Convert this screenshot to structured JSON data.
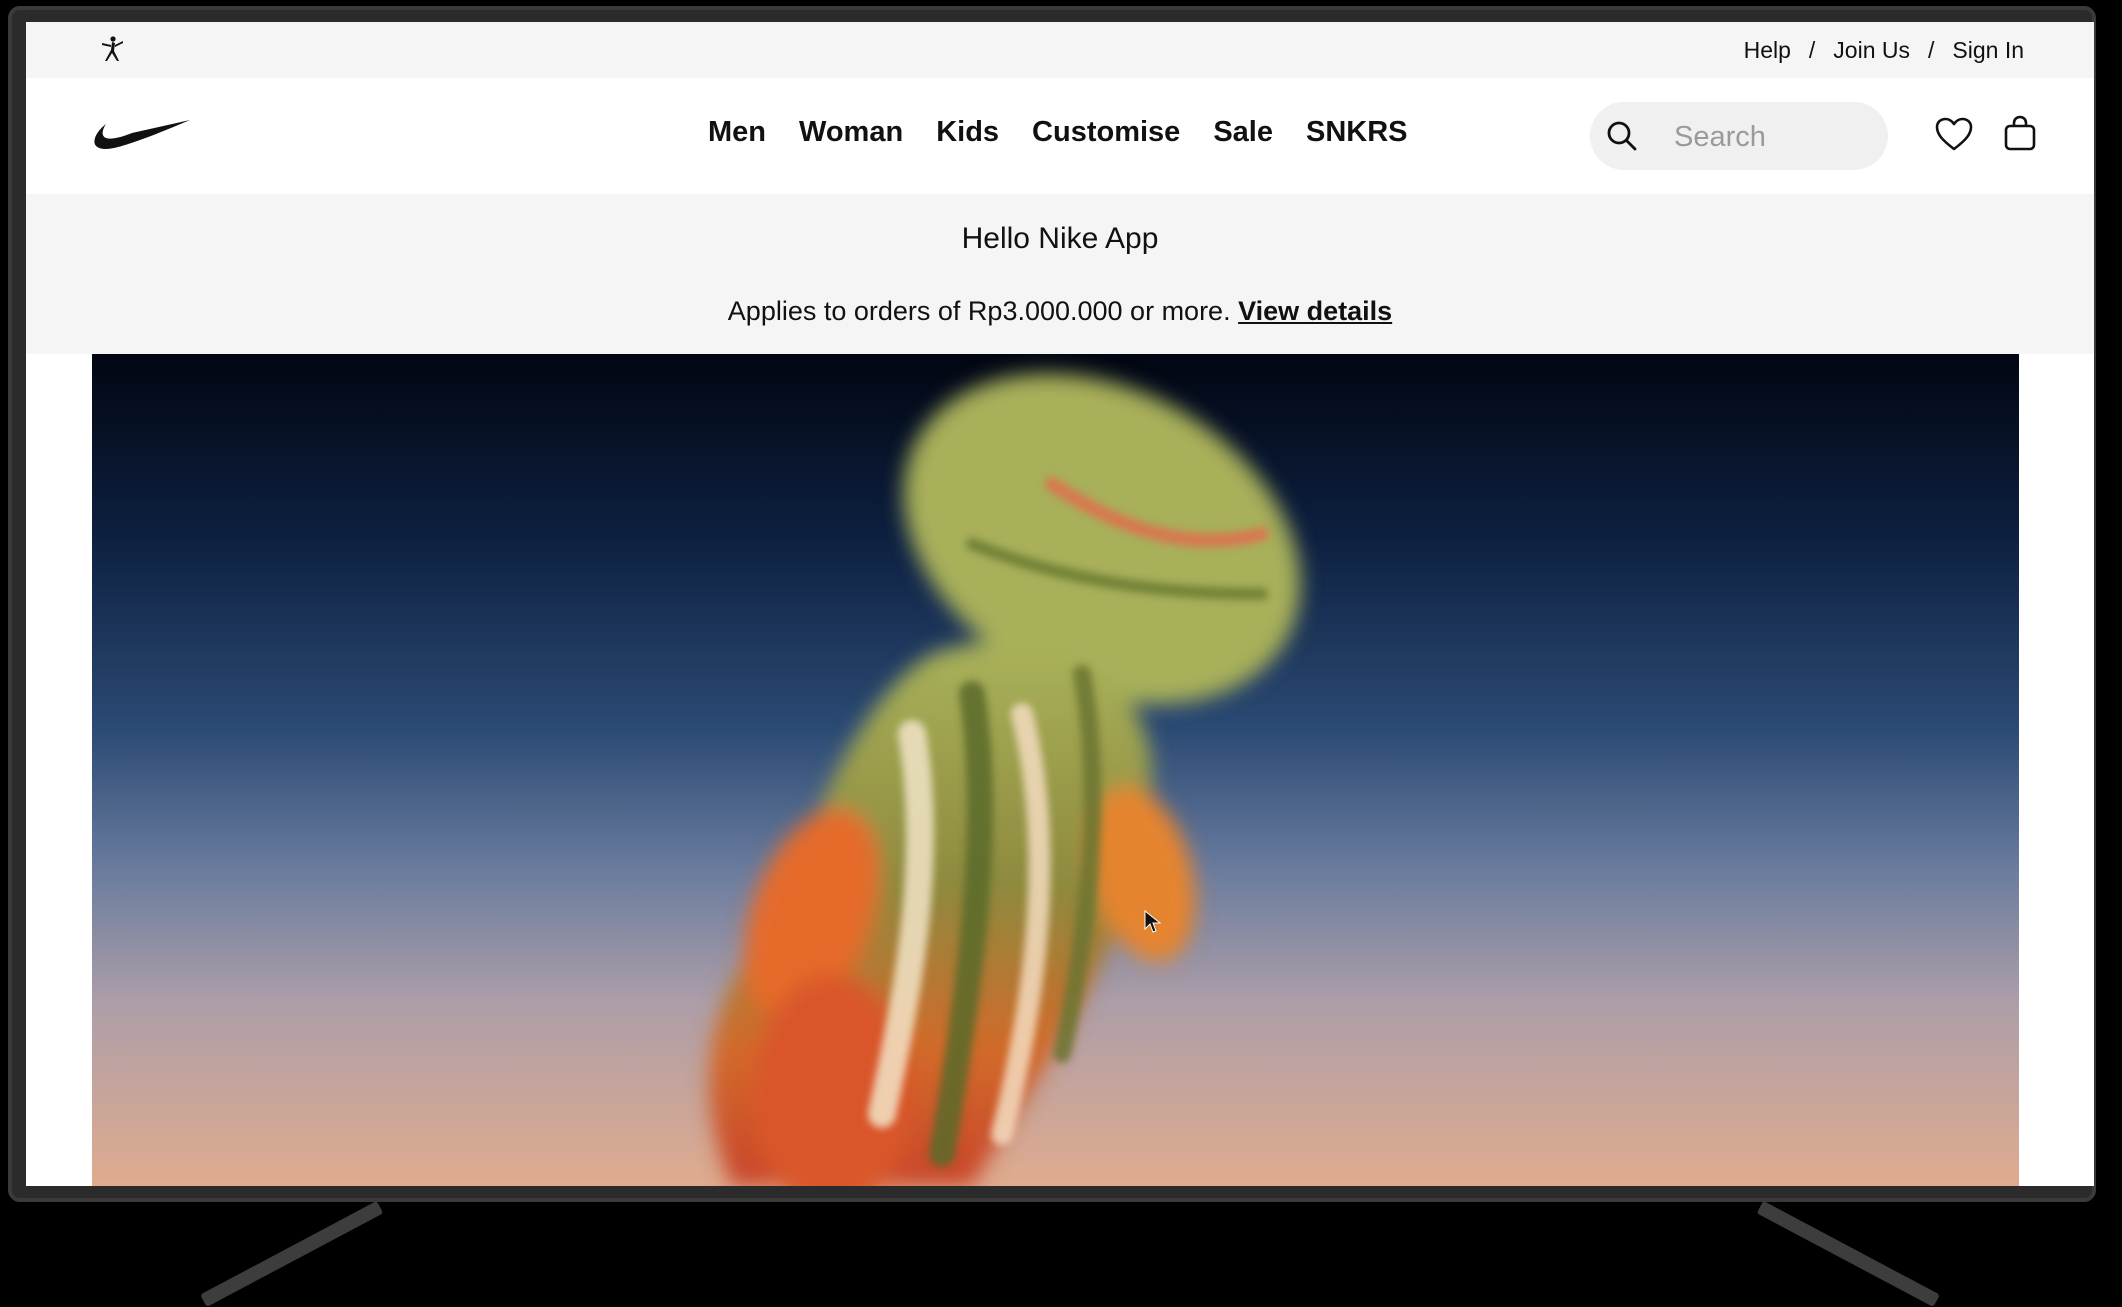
{
  "utility": {
    "help": "Help",
    "sep1": "/",
    "join": "Join Us",
    "sep2": "/",
    "signin": "Sign In"
  },
  "nav": {
    "items": [
      "Men",
      "Woman",
      "Kids",
      "Customise",
      "Sale",
      "SNKRS"
    ]
  },
  "search": {
    "placeholder": "Search",
    "value": ""
  },
  "promo": {
    "title": "Hello Nike App",
    "text": "Applies to orders of Rp3.000.000 or more.",
    "link": "View details"
  },
  "icons": {
    "brand_sub": "jordan-jumpman-icon",
    "brand": "nike-swoosh-icon",
    "search": "search-icon",
    "favorites": "heart-icon",
    "bag": "bag-icon"
  },
  "colors": {
    "text": "#111111",
    "bar_bg": "#f5f5f5",
    "search_bg": "#f0f0f0"
  }
}
